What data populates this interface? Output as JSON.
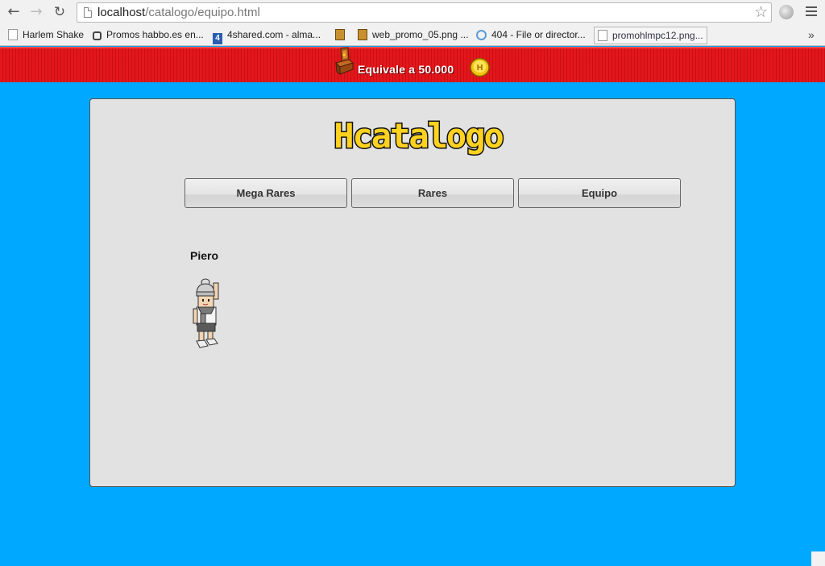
{
  "browser": {
    "url_host": "localhost",
    "url_path": "/catalogo/equipo.html",
    "bookmarks": [
      {
        "label": "Harlem Shake",
        "icon": "page-icon"
      },
      {
        "label": "Promos habbo.es en...",
        "icon": "gear-icon"
      },
      {
        "label": "4shared.com - alma...",
        "icon": "4shared-icon"
      },
      {
        "label": "",
        "icon": "box-icon"
      },
      {
        "label": "web_promo_05.png ...",
        "icon": "box-icon"
      },
      {
        "label": "404 - File or director...",
        "icon": "sync-icon"
      },
      {
        "label": "promohlmpc12.png...",
        "icon": "page-icon"
      }
    ],
    "bookmarks_more": "»"
  },
  "banner": {
    "text": "Equivale a 50.000",
    "color": "#e1141a"
  },
  "catalog": {
    "logo_text": "Hcatalogo",
    "tabs": [
      {
        "label": "Mega Rares"
      },
      {
        "label": "Rares"
      },
      {
        "label": "Equipo"
      }
    ],
    "member_name": "Piero"
  },
  "colors": {
    "background": "#00a8ff",
    "panel": "#e2e2e2",
    "logo_yellow": "#ffd21f",
    "logo_blue": "#5fc4ff"
  }
}
